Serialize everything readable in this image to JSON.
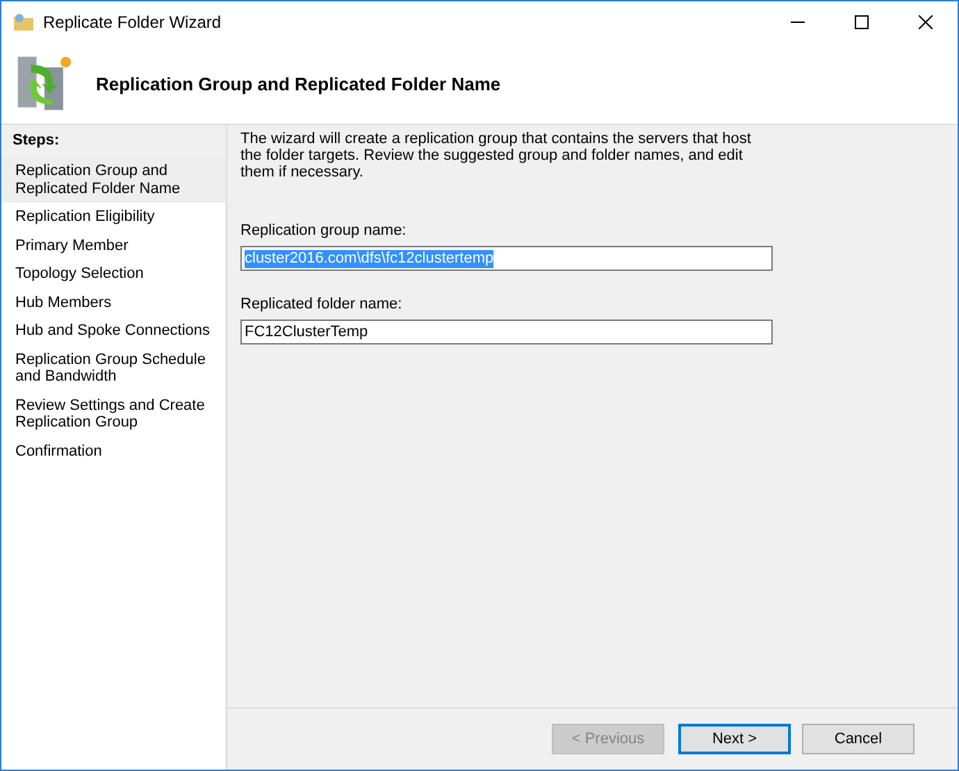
{
  "window": {
    "title": "Replicate Folder Wizard"
  },
  "header": {
    "title": "Replication Group and Replicated Folder Name"
  },
  "steps": {
    "heading": "Steps:",
    "items": [
      {
        "label": "Replication Group and Replicated Folder Name",
        "selected": true
      },
      {
        "label": "Replication Eligibility",
        "selected": false
      },
      {
        "label": "Primary Member",
        "selected": false
      },
      {
        "label": "Topology Selection",
        "selected": false
      },
      {
        "label": "Hub Members",
        "selected": false
      },
      {
        "label": "Hub and Spoke Connections",
        "selected": false
      },
      {
        "label": "Replication Group Schedule and Bandwidth",
        "selected": false
      },
      {
        "label": "Review Settings and Create Replication Group",
        "selected": false
      },
      {
        "label": "Confirmation",
        "selected": false
      }
    ]
  },
  "intro": "The wizard will create a replication group that contains the servers that host the folder targets. Review the suggested group and folder names, and edit them if necessary.",
  "fields": [
    {
      "label": "Replication group name:",
      "value": "cluster2016.com\\dfs\\fc12clustertemp",
      "text_selected": true
    },
    {
      "label": "Replicated folder name:",
      "value": "FC12ClusterTemp",
      "text_selected": false
    }
  ],
  "buttons": [
    {
      "label": "< Previous",
      "disabled": true,
      "default": false
    },
    {
      "label": "Next >",
      "disabled": false,
      "default": true
    },
    {
      "label": "Cancel",
      "disabled": false,
      "default": false
    }
  ]
}
